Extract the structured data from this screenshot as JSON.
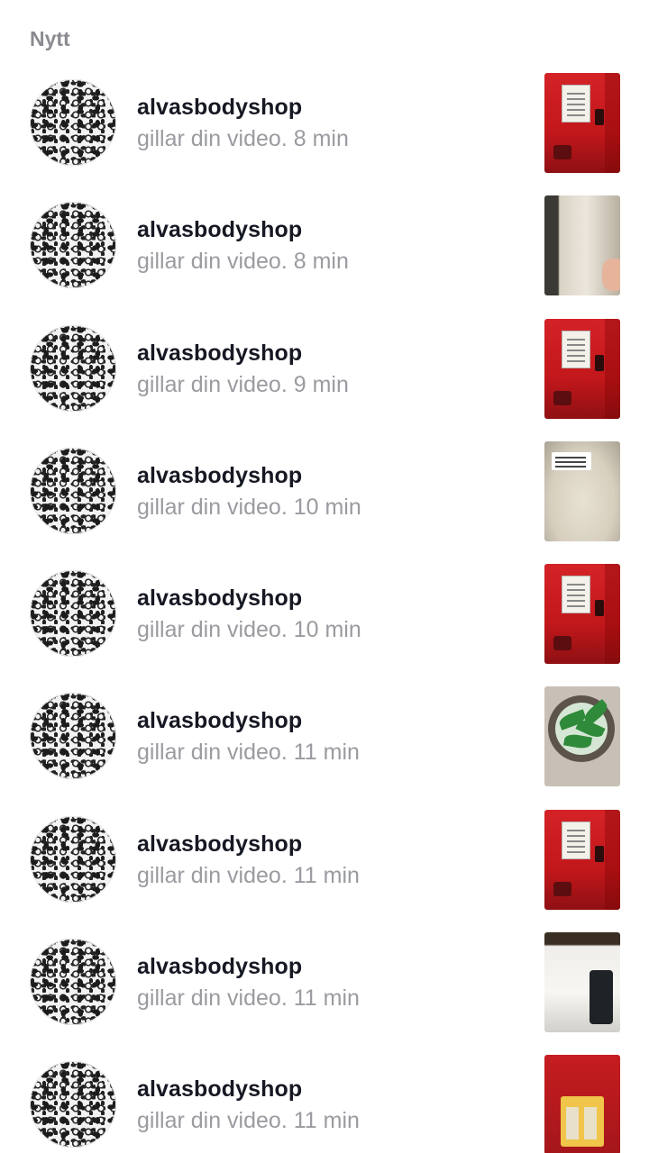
{
  "section": {
    "title": "Nytt"
  },
  "notifications": [
    {
      "username": "alvasbodyshop",
      "activity": "gillar din video.",
      "time": "8 min",
      "thumbnail": "red-box"
    },
    {
      "username": "alvasbodyshop",
      "activity": "gillar din video.",
      "time": "8 min",
      "thumbnail": "paper"
    },
    {
      "username": "alvasbodyshop",
      "activity": "gillar din video.",
      "time": "9 min",
      "thumbnail": "red-box"
    },
    {
      "username": "alvasbodyshop",
      "activity": "gillar din video.",
      "time": "10 min",
      "thumbnail": "cream"
    },
    {
      "username": "alvasbodyshop",
      "activity": "gillar din video.",
      "time": "10 min",
      "thumbnail": "red-box"
    },
    {
      "username": "alvasbodyshop",
      "activity": "gillar din video.",
      "time": "11 min",
      "thumbnail": "leaves"
    },
    {
      "username": "alvasbodyshop",
      "activity": "gillar din video.",
      "time": "11 min",
      "thumbnail": "red-box"
    },
    {
      "username": "alvasbodyshop",
      "activity": "gillar din video.",
      "time": "11 min",
      "thumbnail": "fabric"
    },
    {
      "username": "alvasbodyshop",
      "activity": "gillar din video.",
      "time": "11 min",
      "thumbnail": "gift-box"
    }
  ],
  "colors": {
    "header": "#8a8b91",
    "username": "#161823",
    "secondary": "#9a9ba0",
    "accent_red": "#d42327"
  }
}
